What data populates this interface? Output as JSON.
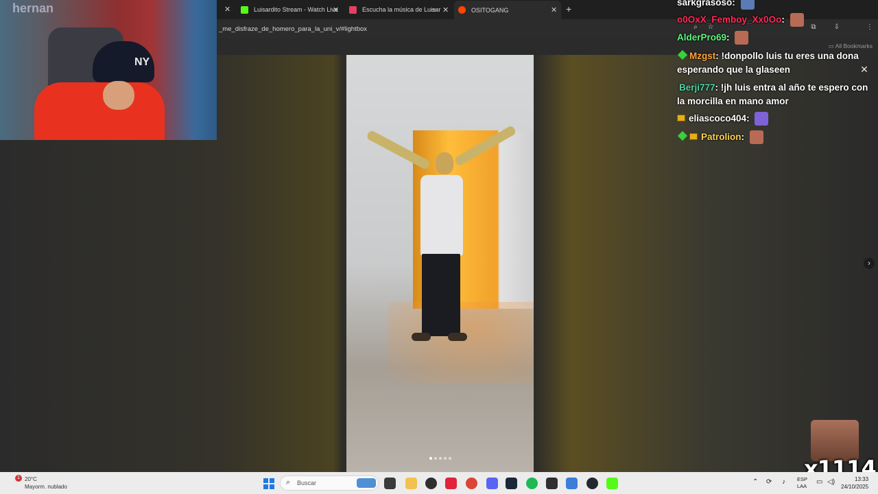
{
  "browser": {
    "tabs": [
      {
        "title": "Luisardito Stream - Watch Live",
        "favicon_color": "#53fc18",
        "active": false
      },
      {
        "title": "Escucha la música de Luisar",
        "favicon_color": "#e4405f",
        "active": false
      },
      {
        "title": "OSITOGANG",
        "favicon_color": "#ff4500",
        "active": true
      }
    ],
    "new_tab_symbol": "+",
    "url": "_me_disfraze_de_homero_para_la_uni_v/#lightbox",
    "bookmarks_label": "All Bookmarks"
  },
  "lightbox": {
    "close_symbol": "✕",
    "next_symbol": "›",
    "carousel_dots": 5,
    "carousel_active_index": 0
  },
  "webcam": {
    "neon_text": "hernan",
    "cap_logo": "NY"
  },
  "chat": {
    "messages": [
      {
        "user": "sarkgrasoso",
        "user_color": "#ffffff",
        "text": "",
        "badges": [],
        "emote": true
      },
      {
        "user": "o0OxX_Femboy_Xx0Oo",
        "user_color": "#ff2a55",
        "text": "",
        "badges": [],
        "emote": true
      },
      {
        "user": "AlderPro69",
        "user_color": "#5cf77d",
        "text": "",
        "badges": [],
        "emote": true
      },
      {
        "user": "Mzgst",
        "user_color": "#ffa63a",
        "text": "!donpollo luis tu eres una dona esperando que la glaseen",
        "badges": [
          "diamond"
        ],
        "emote": false
      },
      {
        "user": "Berji777",
        "user_color": "#4dd6a8",
        "text": "!jh luis entra al año te espero con la morcilla en mano amor",
        "badges": [],
        "emote": false
      },
      {
        "user": "eliascoco404",
        "user_color": "#ffffff",
        "text": "",
        "badges": [
          "crown"
        ],
        "emote": true
      },
      {
        "user": "Patrolion",
        "user_color": "#ffd24a",
        "text": "",
        "badges": [
          "diamond",
          "crown"
        ],
        "emote": true
      }
    ],
    "separator": ": "
  },
  "overlay": {
    "counter_text": "x1114"
  },
  "taskbar": {
    "weather_temp": "20°C",
    "weather_desc": "Mayorm. nublado",
    "weather_badge": "1",
    "search_placeholder": "Buscar",
    "lang_top": "ESP",
    "lang_bottom": "LAA",
    "time": "13:33",
    "date": "24/10/2025",
    "pinned_apps": [
      {
        "name": "task-view",
        "color": "#3a3a3a"
      },
      {
        "name": "file-explorer",
        "color": "#f2c14e"
      },
      {
        "name": "xbox",
        "color": "#2f2f2f"
      },
      {
        "name": "app-red",
        "color": "#e0243a"
      },
      {
        "name": "chrome",
        "color": "#db4437"
      },
      {
        "name": "discord",
        "color": "#5865f2"
      },
      {
        "name": "steam",
        "color": "#1b2838"
      },
      {
        "name": "spotify",
        "color": "#1db954"
      },
      {
        "name": "obs",
        "color": "#302e31"
      },
      {
        "name": "notepad",
        "color": "#3b7dd8"
      },
      {
        "name": "github-desktop",
        "color": "#24292f"
      },
      {
        "name": "kick",
        "color": "#53fc18"
      }
    ]
  }
}
